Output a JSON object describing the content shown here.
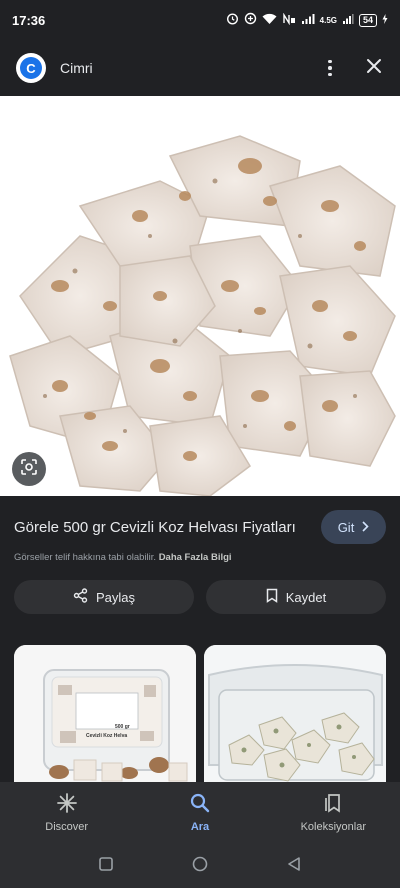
{
  "status": {
    "time": "17:36",
    "network": "4.5G",
    "battery": "54"
  },
  "header": {
    "site_logo_letter": "C",
    "site_name": "Cimri"
  },
  "result": {
    "title": "Görele 500 gr Cevizli Koz Helvası Fiyatları",
    "visit_label": "Git",
    "copyright_text": "Görseller telif hakkına tabi olabilir.",
    "more_info_label": "Daha Fazla Bilgi"
  },
  "actions": {
    "share_label": "Paylaş",
    "save_label": "Kaydet"
  },
  "related": {
    "card1_label_line1": "500 gr",
    "card1_label_line2": "Cevizli Koz Helva"
  },
  "bottom_nav": {
    "items": [
      {
        "label": "Discover",
        "icon": "asterisk-icon"
      },
      {
        "label": "Ara",
        "icon": "search-icon"
      },
      {
        "label": "Koleksiyonlar",
        "icon": "collections-icon"
      }
    ],
    "active_index": 1
  },
  "colors": {
    "background": "#202124",
    "accent": "#8ab4f8",
    "visit_button": "#394457",
    "site_logo": "#1a73e8"
  }
}
